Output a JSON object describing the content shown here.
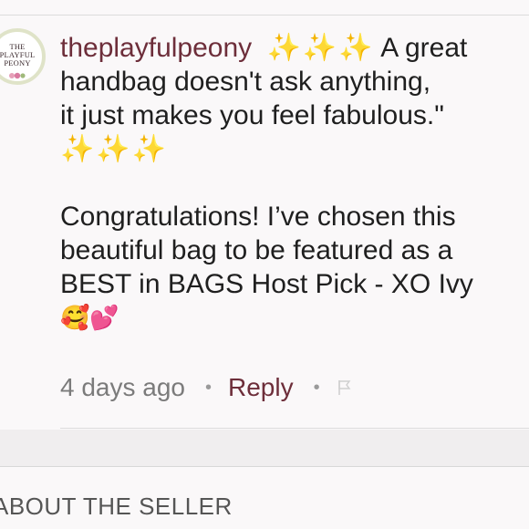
{
  "avatar": {
    "line1": "THE",
    "line2": "PLAYFUL",
    "line3": "PEONY"
  },
  "comment": {
    "username": "theplayfulpeony",
    "sparkles_lead": "✨✨✨",
    "text_line1": "A great",
    "text_line2": "handbag doesn't ask anything,",
    "text_line3": "it just makes you feel fabulous.\"",
    "sparkles_trail": "✨✨✨",
    "para2_line1": "Congratulations! I’ve chosen this",
    "para2_line2": "beautiful bag to be featured as a",
    "para2_line3": "BEST in BAGS Host Pick - XO Ivy",
    "emojis": "🥰💕"
  },
  "meta": {
    "time": "4 days ago",
    "separator": "•",
    "reply": "Reply"
  },
  "section": {
    "title": "ABOUT THE SELLER"
  },
  "colors": {
    "username": "#6d2e3a",
    "reply": "#6d2e3a",
    "sparkle": "#f2c94c",
    "background": "#faf8f9"
  }
}
